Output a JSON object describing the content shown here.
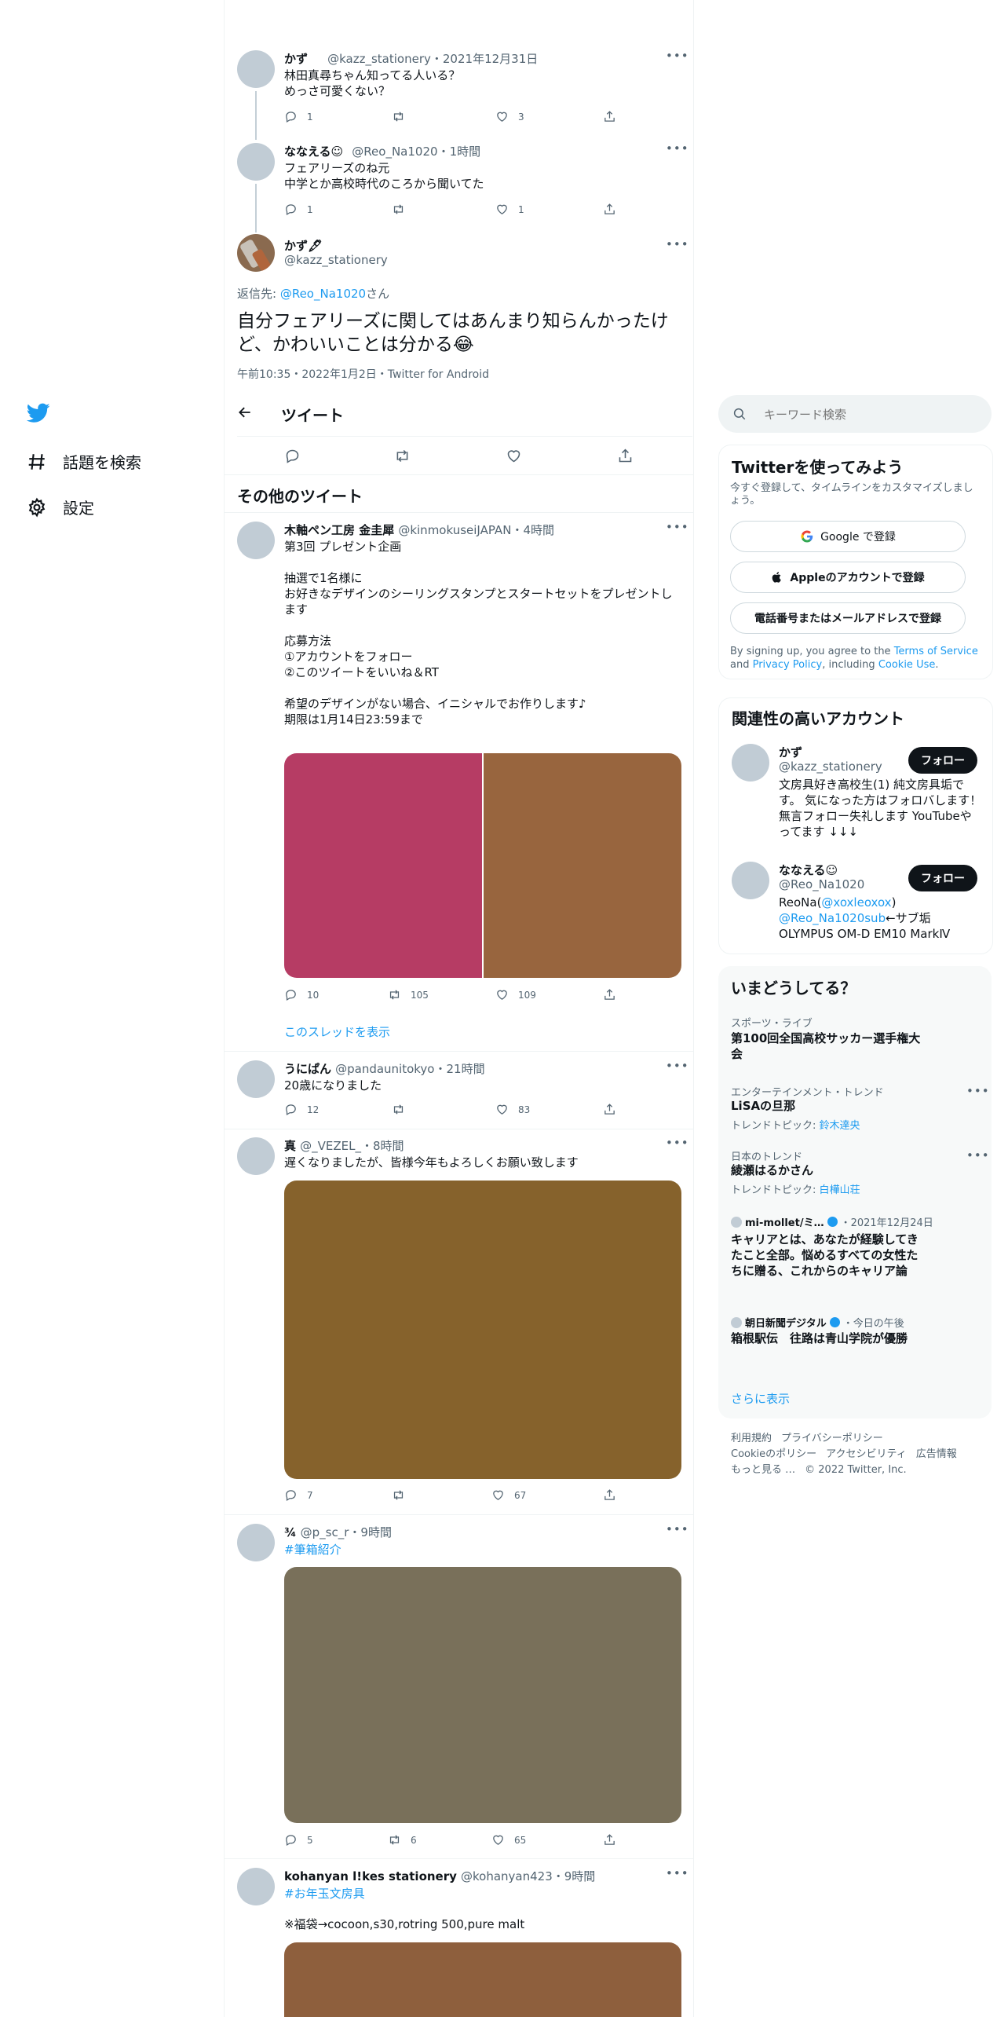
{
  "nav": {
    "explore_label": "話題を検索",
    "settings_label": "設定"
  },
  "thread": {
    "tweet1": {
      "name": "かず",
      "handle": "@kazz_stationery",
      "time": "2021年12月31日",
      "text": "林田真尋ちゃん知ってる人いる？\nめっさ可愛くない？",
      "replies": "1",
      "retweets": "",
      "likes": "3"
    },
    "tweet2": {
      "name": "ななえる☺︎",
      "handle": "@Reo_Na1020",
      "time": "1時間",
      "text": "フェアリーズのね元\n中学とか高校時代のころから聞いてた",
      "replies": "1",
      "retweets": "",
      "likes": "1"
    },
    "main": {
      "name": "かず🖋",
      "handle": "@kazz_stationery",
      "reply_prefix": "返信先: ",
      "reply_to": "@Reo_Na1020",
      "reply_suffix": "さん",
      "text": "自分フェアリーズに関してはあんまり知らんかったけど、かわいいことは分かる😂",
      "meta": "午前10:35・2022年1月2日・Twitter for Android"
    }
  },
  "header": {
    "title": "ツイート"
  },
  "more_tweets_heading": "その他のツイート",
  "tweets": {
    "t1": {
      "name": "木軸ペン工房 金圭犀",
      "handle": "@kinmokuseiJAPAN",
      "time": "4時間",
      "text": "第3回 プレゼント企画\n\n抽選で1名様に\nお好きなデザインのシーリングスタンプとスタートセットをプレゼントします\n\n応募方法\n①アカウントをフォロー\n②このツイートをいいね＆RT\n\n希望のデザインがない場合、イニシャルでお作りします♪\n期限は1月14日23:59まで",
      "replies": "10",
      "retweets": "105",
      "likes": "109",
      "show_thread": "このスレッドを表示",
      "media_colors": [
        "#b63c64",
        "#98653e"
      ]
    },
    "t2": {
      "name": "うにぱん",
      "handle": "@pandaunitokyo",
      "time": "21時間",
      "text": "20歳になりました",
      "replies": "12",
      "retweets": "",
      "likes": "83"
    },
    "t3": {
      "name": "真",
      "handle": "@_VEZEL_",
      "time": "8時間",
      "text": "遅くなりましたが、皆様今年もよろしくお願い致します",
      "replies": "7",
      "retweets": "",
      "likes": "67",
      "media_color": "#86622c"
    },
    "t4": {
      "name": "¾",
      "handle": "@p_sc_r",
      "time": "9時間",
      "hashtag": "#筆箱紹介",
      "replies": "5",
      "retweets": "6",
      "likes": "65",
      "media_color": "#79705a"
    },
    "t5": {
      "name": "kohanyan l!kes stationery",
      "handle": "@kohanyan423",
      "time": "9時間",
      "hashtag": "#お年玉文房具",
      "text": "※福袋→cocoon,s30,rotring 500,pure malt",
      "media_color": "#8e5f3d"
    }
  },
  "search": {
    "placeholder": "キーワード検索"
  },
  "signup": {
    "title": "Twitterを使ってみよう",
    "subtitle": "今すぐ登録して、タイムラインをカスタマイズしましょう。",
    "google": "Google で登録",
    "apple": "Appleのアカウントで登録",
    "phone": "電話番号またはメールアドレスで登録",
    "legal_1": "By signing up, you agree to the ",
    "terms": "Terms of Service",
    "legal_2": " and ",
    "privacy": "Privacy Policy",
    "legal_3": ", including ",
    "cookie": "Cookie Use",
    "legal_4": "."
  },
  "related": {
    "title": "関連性の高いアカウント",
    "follow_label": "フォロー",
    "acc1": {
      "name": "かず",
      "handle": "@kazz_stationery",
      "bio": "文房具好き高校生(1) 純文房具垢です。 気になった方はフォロバします！ 無言フォロー失礼します YouTubeやってます ↓↓↓"
    },
    "acc2": {
      "name": "ななえる☺︎",
      "handle": "@Reo_Na1020",
      "bio_1": "ReoNa(",
      "bio_link1": "@xoxleoxox",
      "bio_2": ")",
      "bio_link2": "@Reo_Na1020sub",
      "bio_3": "←サブ垢",
      "bio_4": "OLYMPUS OM-D EM10 MarkⅣ"
    }
  },
  "trends": {
    "title": "いまどうしてる？",
    "tr1": {
      "category": "スポーツ・ライブ",
      "title": "第100回全国高校サッカー選手権大会"
    },
    "tr2": {
      "category": "エンターテインメント・トレンド",
      "title": "LiSAの旦那",
      "sub_prefix": "トレンドトピック: ",
      "sub_link": "鈴木達央"
    },
    "tr3": {
      "category": "日本のトレンド",
      "title": "綾瀬はるかさん",
      "sub_prefix": "トレンドトピック: ",
      "sub_link": "白樺山荘"
    },
    "tr4": {
      "source": "mi-mollet/ミ…",
      "time": "・2021年12月24日",
      "title": "キャリアとは、あなたが経験してきたこと全部。悩めるすべての女性たちに贈る、これからのキャリア論"
    },
    "tr5": {
      "source": "朝日新聞デジタル",
      "time": "・今日の午後",
      "title": "箱根駅伝　往路は青山学院が優勝"
    },
    "show_more": "さらに表示"
  },
  "footer": {
    "terms": "利用規約",
    "privacy": "プライバシーポリシー",
    "cookie": "Cookieのポリシー",
    "accessibility": "アクセシビリティ",
    "ads": "広告情報",
    "more": "もっと見る …",
    "copyright": "© 2022 Twitter, Inc."
  },
  "colors": {
    "accent": "#1d9bf0",
    "text": "#0f1419",
    "secondary": "#536471"
  }
}
